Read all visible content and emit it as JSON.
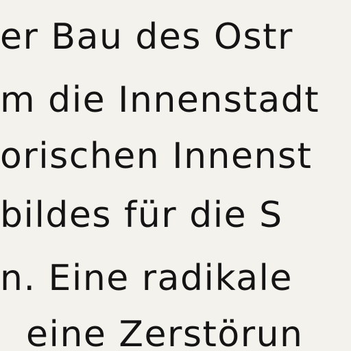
{
  "document": {
    "lines": [
      "er Bau des Ostr",
      "m die Innenstadt",
      "orischen Innenst",
      "bildes für die S",
      "n. Eine radikale",
      "eine Zerstörun"
    ]
  }
}
